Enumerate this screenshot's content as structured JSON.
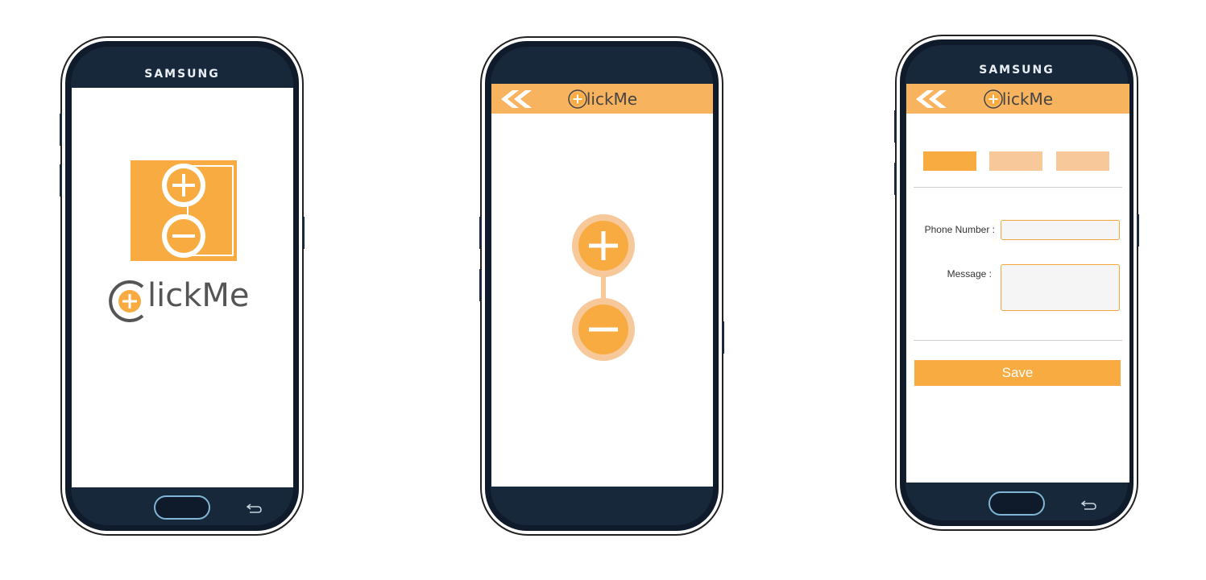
{
  "screens": [
    {
      "id": "splash",
      "brand": "SAMSUNG",
      "logo_text": "lickMe",
      "logo_initial_icon": "plus-circle-c-icon",
      "hero_icon": "plus-minus-card-icon"
    },
    {
      "id": "home",
      "brand": "",
      "app_title": "lickMe",
      "back_icon": "double-chevron-left-icon",
      "actions": [
        "plus-button",
        "minus-button"
      ]
    },
    {
      "id": "form",
      "brand": "SAMSUNG",
      "app_title": "lickMe",
      "tabs": [
        {
          "label": "",
          "state": "active"
        },
        {
          "label": "",
          "state": "inactive"
        },
        {
          "label": "",
          "state": "inactive"
        }
      ],
      "phone_label": "Phone Number :",
      "phone_value": "",
      "message_label": "Message :",
      "message_value": "",
      "save_label": "Save"
    }
  ],
  "colors": {
    "accent": "#f8ab40",
    "appbar": "#f8b35e",
    "accent_light": "#f7c89a",
    "phone_body": "#0f1b2a",
    "text_dark": "#444444"
  }
}
